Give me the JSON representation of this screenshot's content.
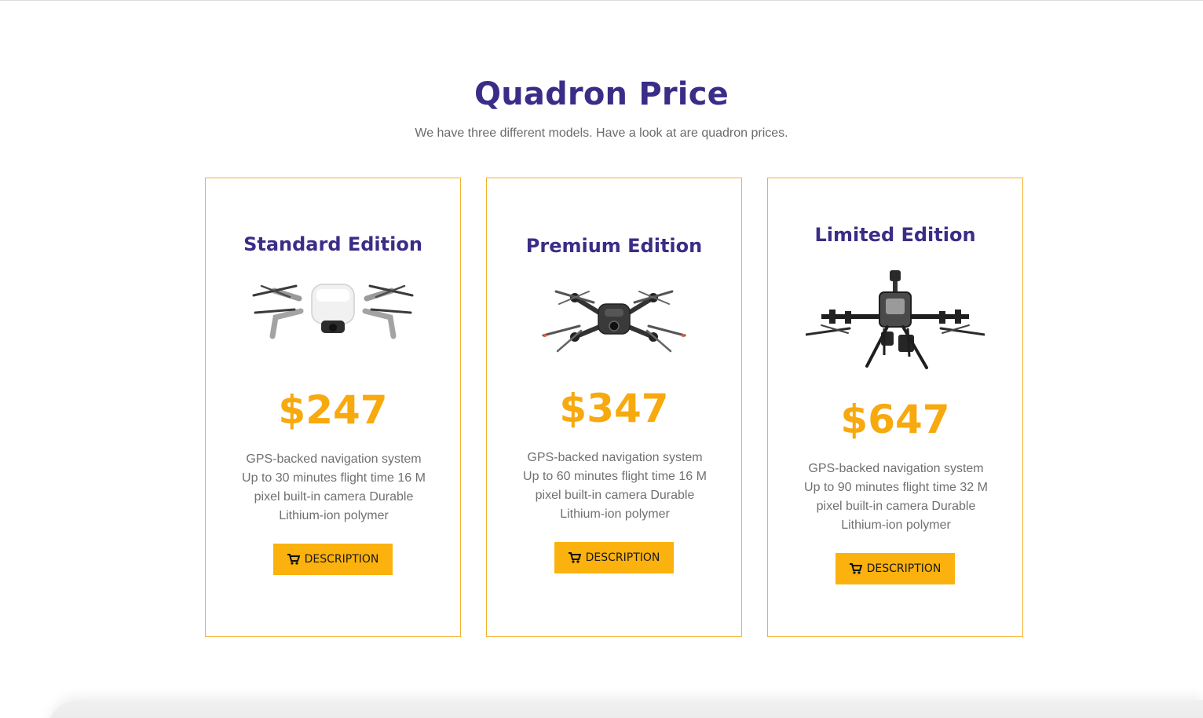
{
  "section": {
    "title": "Quadron Price",
    "subtitle": "We have three different models. Have a look at are quadron prices."
  },
  "cards": [
    {
      "title": "Standard Edition",
      "price": "$247",
      "features": "GPS-backed navigation system Up to 30 minutes flight time 16 M pixel built-in camera Durable Lithium-ion polymer",
      "button_label": "DESCRIPTION",
      "image": "white-folding-drone"
    },
    {
      "title": "Premium Edition",
      "price": "$347",
      "features": "GPS-backed navigation system Up to 60 minutes flight time 16 M pixel built-in camera Durable Lithium-ion polymer",
      "button_label": "DESCRIPTION",
      "image": "dark-fpv-drone"
    },
    {
      "title": "Limited Edition",
      "price": "$647",
      "features": "GPS-backed navigation system Up to 90 minutes flight time 32 M pixel built-in camera Durable Lithium-ion polymer",
      "button_label": "DESCRIPTION",
      "image": "industrial-quad-drone"
    }
  ],
  "icons": {
    "button_icon": "cart-icon"
  },
  "colors": {
    "heading": "#3a2d87",
    "price": "#f7a90e",
    "button": "#fbb10e",
    "card_border": "#f6b12b",
    "body_text": "#707070"
  }
}
